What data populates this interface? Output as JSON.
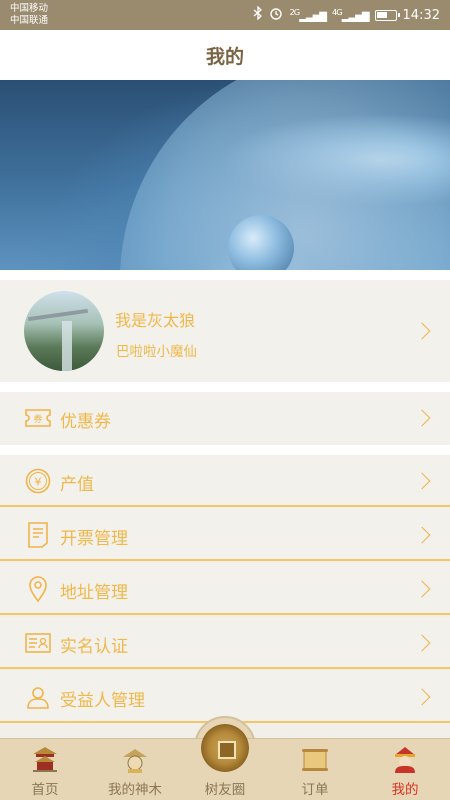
{
  "status_bar": {
    "carrier_1": "中国移动",
    "carrier_2": "中国联通",
    "network_1": "2G",
    "network_2": "4G",
    "time": "14:32",
    "icons": [
      "bluetooth-icon",
      "alarm-icon",
      "signal-icon",
      "signal-icon",
      "battery-icon"
    ]
  },
  "header": {
    "title": "我的"
  },
  "profile": {
    "name": "我是灰太狼",
    "subtitle": "巴啦啦小魔仙"
  },
  "menu": {
    "coupon": "优惠券",
    "output_value": "产值",
    "invoice": "开票管理",
    "address": "地址管理",
    "real_name": "实名认证",
    "beneficiary": "受益人管理"
  },
  "tabbar": {
    "home": "首页",
    "my_trees": "我的神木",
    "friends": "树友圈",
    "orders": "订单",
    "mine": "我的"
  },
  "colors": {
    "accent": "#f0b84a",
    "status_bar": "#9a8a6e",
    "title": "#7a6444",
    "active_tab": "#d53222",
    "tabbar_bg": "#e7d6b6"
  }
}
